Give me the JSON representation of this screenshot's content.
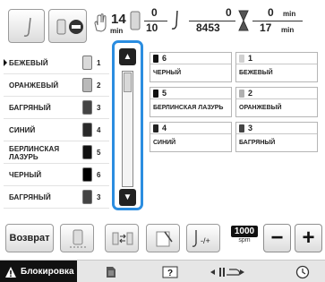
{
  "top": {
    "stitch_icon": "needle-stitch-icon",
    "mode_icon": "embroidery-mode-icon",
    "hand_icon": "hand-icon",
    "time_value": "14",
    "time_unit": "min",
    "thread_current": "0",
    "thread_total": "10",
    "stitch_current": "0",
    "stitch_total": "8453",
    "remaining_time": "0",
    "total_time": "17",
    "remaining_unit": "min",
    "total_unit": "min"
  },
  "color_list": [
    {
      "name": "БЕЖЕВЫЙ",
      "num": "1",
      "color": "#d9d9d9",
      "selected": true
    },
    {
      "name": "ОРАНЖЕВЫЙ",
      "num": "2",
      "color": "#b9b9b9"
    },
    {
      "name": "БАГРЯНЫЙ",
      "num": "3",
      "color": "#444444"
    },
    {
      "name": "СИНИЙ",
      "num": "4",
      "color": "#2a2a2a"
    },
    {
      "name": "БЕРЛИНСКАЯ ЛАЗУРЬ",
      "num": "5",
      "color": "#111111"
    },
    {
      "name": "ЧЕРНЫЙ",
      "num": "6",
      "color": "#000000"
    },
    {
      "name": "БАГРЯНЫЙ",
      "num": "3",
      "color": "#444444"
    }
  ],
  "grid": [
    {
      "num": "6",
      "name": "ЧЕРНЫЙ",
      "color": "#111111"
    },
    {
      "num": "1",
      "name": "БЕЖЕВЫЙ",
      "color": "#d0d0d0"
    },
    {
      "num": "5",
      "name": "БЕРЛИНСКАЯ ЛАЗУРЬ",
      "color": "#111111"
    },
    {
      "num": "2",
      "name": "ОРАНЖЕВЫЙ",
      "color": "#b0b0b0"
    },
    {
      "num": "4",
      "name": "СИНИЙ",
      "color": "#222222"
    },
    {
      "num": "3",
      "name": "БАГРЯНЫЙ",
      "color": "#444444"
    }
  ],
  "toolbar": {
    "back_label": "Возврат",
    "speed_value": "1000",
    "speed_unit": "spm",
    "minus_label": "−",
    "plus_label": "+"
  },
  "status": {
    "lock_label": "Блокировка"
  },
  "colors": {
    "accent": "#2b8de0"
  }
}
